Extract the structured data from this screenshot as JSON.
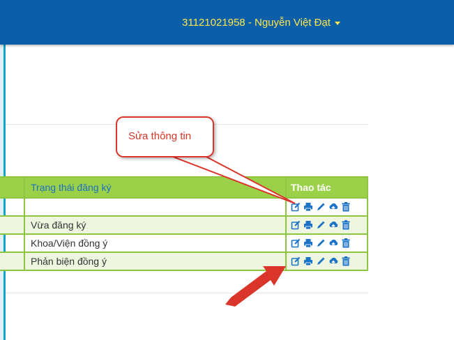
{
  "header": {
    "user_label": "31121021958 - Nguyễn Việt Đạt"
  },
  "table": {
    "columns": [
      "Trạng thái đăng ký",
      "Thao tác"
    ],
    "rows": [
      {
        "status": ""
      },
      {
        "status": "Vừa đăng ký"
      },
      {
        "status": "Khoa/Viện đồng ý"
      },
      {
        "status": "Phản biện đồng ý"
      }
    ],
    "action_icons": [
      "edit-icon",
      "print-icon",
      "pencil-icon",
      "upload-icon",
      "trash-icon"
    ]
  },
  "annotation": {
    "callout_text": "Sửa thông tin"
  },
  "colors": {
    "header_bg": "#0b5ea8",
    "user_text": "#ffe84a",
    "table_header": "#9bd148",
    "row_alt": "#eef6df",
    "icon": "#1a73c7",
    "annotation_red": "#d9352b"
  }
}
